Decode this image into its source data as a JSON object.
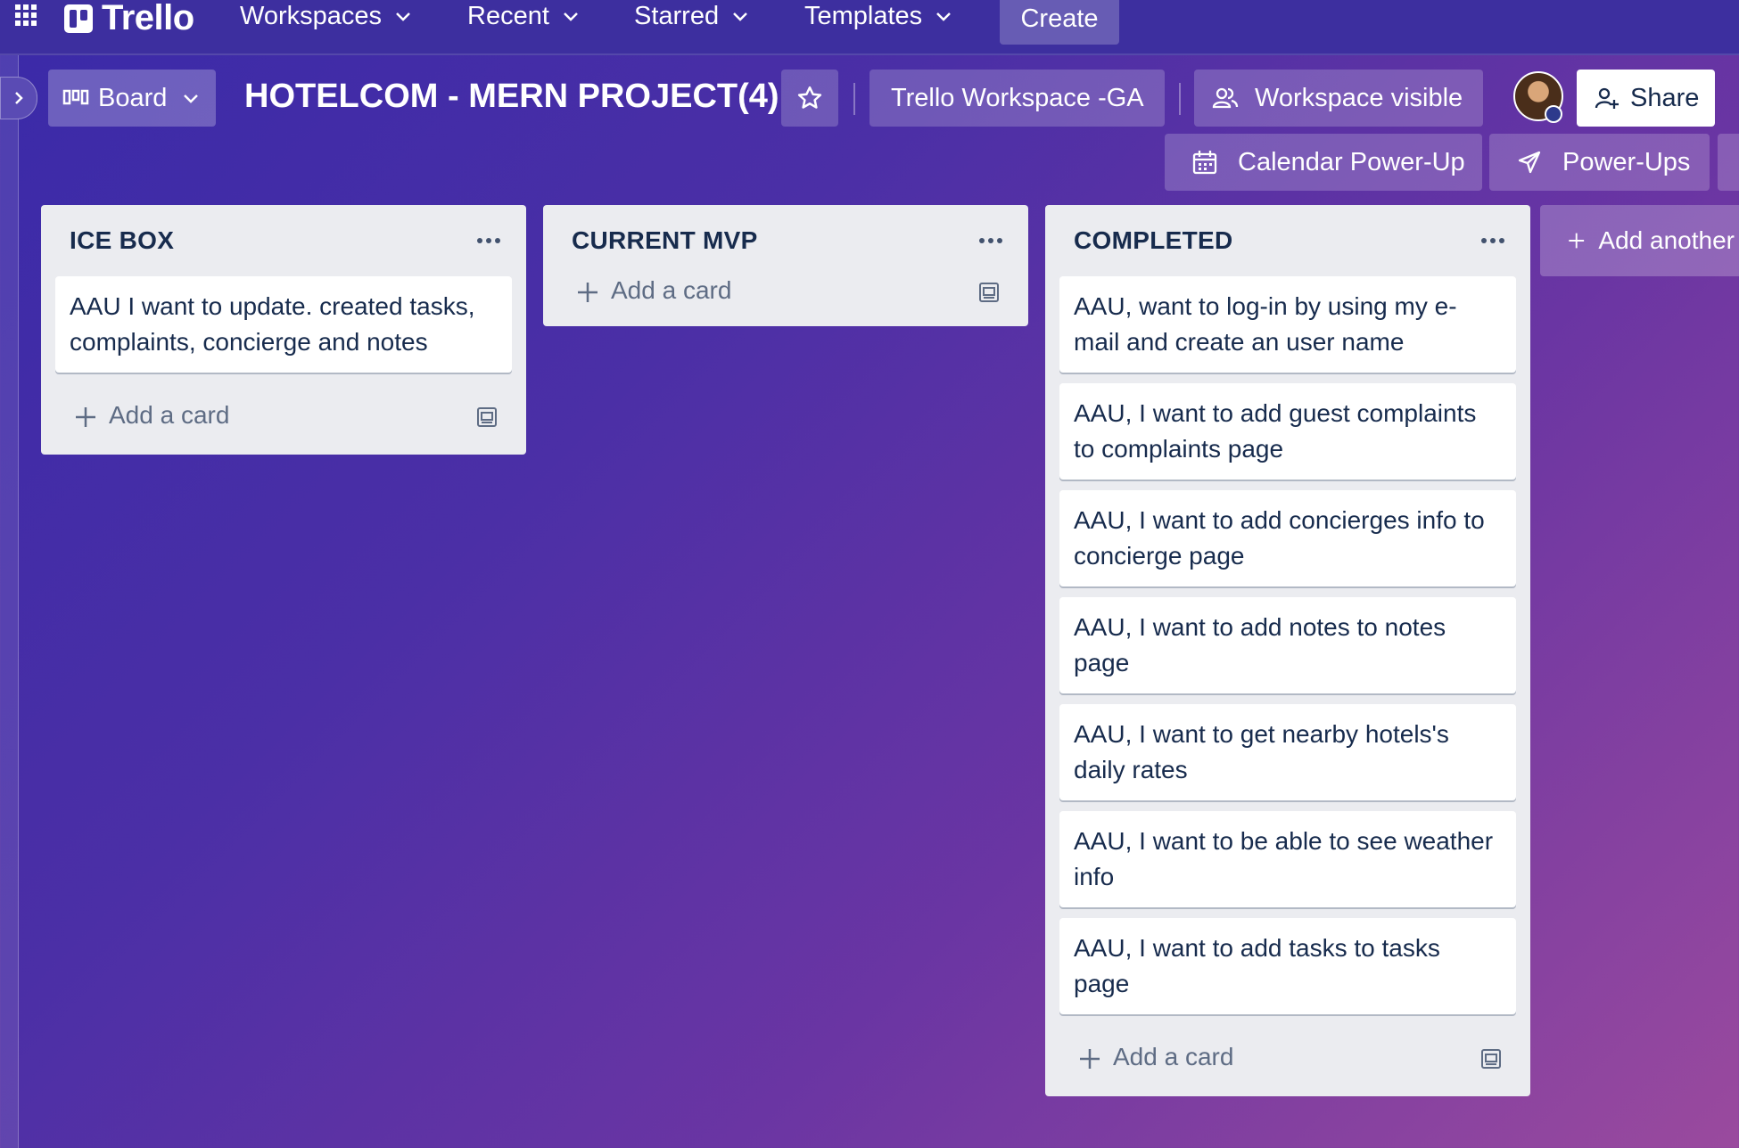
{
  "nav": {
    "brand": "Trello",
    "items": [
      {
        "label": "Workspaces"
      },
      {
        "label": "Recent"
      },
      {
        "label": "Starred"
      },
      {
        "label": "Templates"
      }
    ],
    "create_label": "Create"
  },
  "board": {
    "view_label": "Board",
    "title": "HOTELCOM - MERN PROJECT(4)",
    "workspace_label": "Trello Workspace -GA",
    "visibility_label": "Workspace visible",
    "share_label": "Share",
    "calendar_label": "Calendar Power-Up",
    "powerups_label": "Power-Ups"
  },
  "lists": [
    {
      "title": "ICE BOX",
      "cards": [
        "AAU I want to update. created tasks, complaints, concierge and notes"
      ],
      "add_label": "Add a card"
    },
    {
      "title": "CURRENT MVP",
      "cards": [],
      "add_label": "Add a card"
    },
    {
      "title": "COMPLETED",
      "cards": [
        "AAU, want to log-in by using my e-mail and create an user name",
        "AAU, I want to add guest complaints to complaints page",
        "AAU, I want to add concierges info to concierge page",
        "AAU, I want to add notes to notes page",
        "AAU, I want to get nearby hotels's daily rates",
        "AAU, I want to be able to see weather info",
        "AAU, I want to add tasks to tasks page"
      ],
      "add_label": "Add a card"
    }
  ],
  "add_list_label": "Add another list",
  "colors": {
    "nav_bg": "#3d2f9f",
    "list_bg": "#ebecf0",
    "card_text": "#172b4d",
    "muted_text": "#5e6c84"
  }
}
